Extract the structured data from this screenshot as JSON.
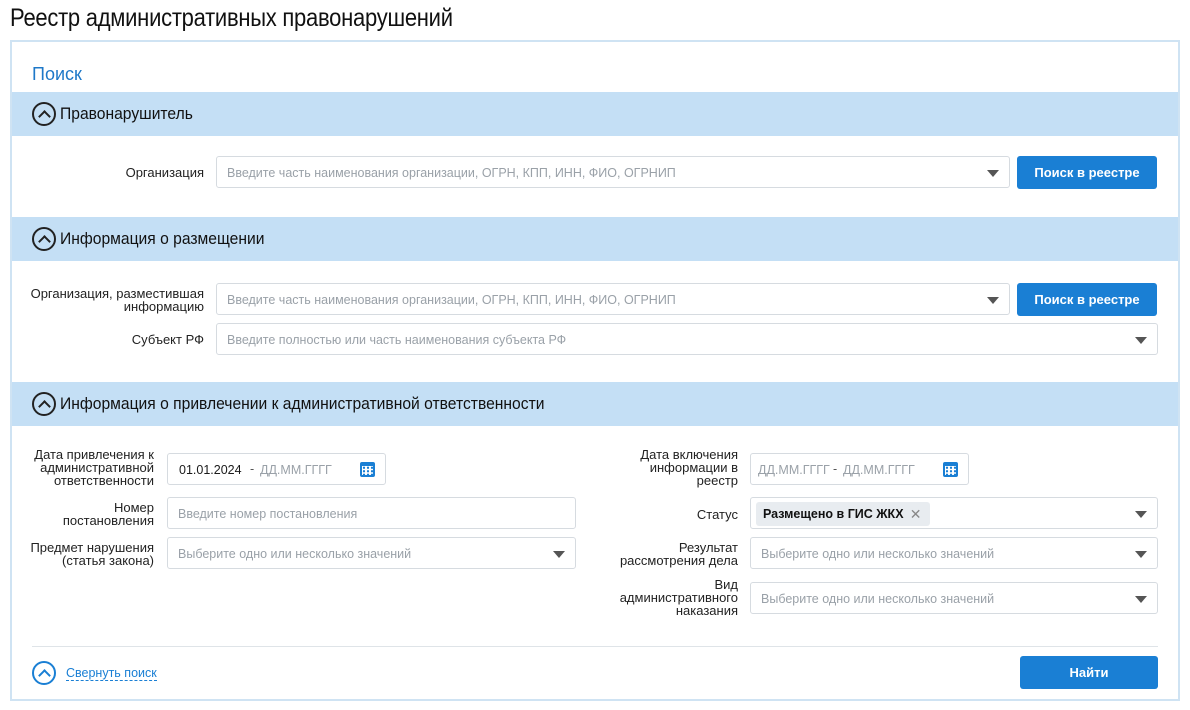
{
  "page": {
    "title": "Реестр административных правонарушений"
  },
  "search": {
    "title": "Поиск"
  },
  "sections": {
    "offender": {
      "title": "Правонарушитель",
      "organization": {
        "label": "Организация",
        "placeholder": "Введите часть наименования организации, ОГРН, КПП, ИНН, ФИО, ОГРНИП",
        "button": "Поиск в реестре"
      }
    },
    "placement": {
      "title": "Информация о размещении",
      "organization": {
        "label_line1": "Организация, разместившая",
        "label_line2": "информацию",
        "placeholder": "Введите часть наименования организации, ОГРН, КПП, ИНН, ФИО, ОГРНИП",
        "button": "Поиск в реестре"
      },
      "subject": {
        "label": "Субъект РФ",
        "placeholder": "Введите полностью или часть наименования субъекта РФ"
      }
    },
    "liability": {
      "title": "Информация о привлечении к административной ответственности",
      "date_liability": {
        "label_line1": "Дата привлечения к",
        "label_line2": "административной",
        "label_line3": "ответственности",
        "from": "01.01.2024",
        "separator": "-",
        "to_placeholder": "ДД.ММ.ГГГГ"
      },
      "decree_number": {
        "label_line1": "Номер",
        "label_line2": "постановления",
        "placeholder": "Введите номер постановления"
      },
      "violation_subject": {
        "label_line1": "Предмет нарушения",
        "label_line2": "(статья закона)",
        "placeholder": "Выберите одно или несколько значений"
      },
      "date_inclusion": {
        "label_line1": "Дата включения",
        "label_line2": "информации в",
        "label_line3": "реестр",
        "from_placeholder": "ДД.ММ.ГГГГ",
        "separator": "-",
        "to_placeholder": "ДД.ММ.ГГГГ"
      },
      "status": {
        "label": "Статус",
        "selected_tag": "Размещено в ГИС ЖКХ",
        "remove_glyph": "✕"
      },
      "result": {
        "label_line1": "Результат",
        "label_line2": "рассмотрения дела",
        "placeholder": "Выберите одно или несколько значений"
      },
      "punishment": {
        "label_line1": "Вид",
        "label_line2": "административного",
        "label_line3": "наказания",
        "placeholder": "Выберите одно или несколько значений"
      }
    }
  },
  "footer": {
    "collapse_label": "Свернуть поиск",
    "find_button": "Найти"
  },
  "colors": {
    "accent": "#1a7fd4",
    "section_header_bg": "#c4dff5",
    "panel_border": "#cfe3f3"
  }
}
